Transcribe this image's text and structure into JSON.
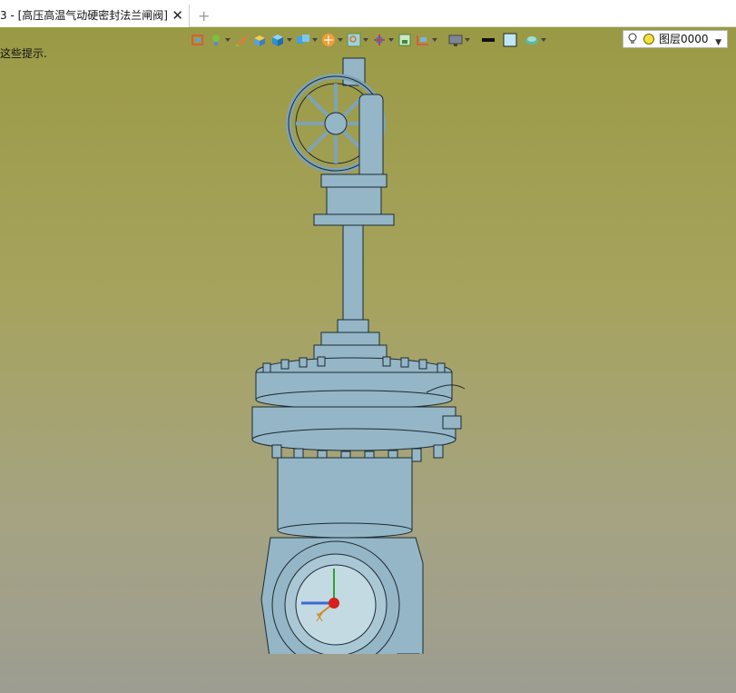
{
  "tab": {
    "title": "3 - [高压高温气动硬密封法兰闸阀]",
    "close_glyph": "✕",
    "new_tab_glyph": "+"
  },
  "hint": {
    "text": "这些提示."
  },
  "toolbar": {
    "icons": [
      "view-orient-icon",
      "light-bulb-icon",
      "pen-icon",
      "shaded-box-icon",
      "solid-box-icon",
      "section-box-icon",
      "render-ball-icon",
      "zoom-icon",
      "axis-icon",
      "frame-icon",
      "dimension-icon",
      "display-icon",
      "line-weight-icon",
      "fill-color-icon",
      "surface-icon"
    ]
  },
  "layer": {
    "value": "图层0000",
    "arrow_glyph": "▼"
  },
  "model": {
    "axis_label": "X"
  },
  "colors": {
    "viewport_top": "#9a9a45",
    "viewport_bottom": "#9d9d92",
    "model_fill": "#94b6c6",
    "model_edge": "#1d2a33"
  }
}
